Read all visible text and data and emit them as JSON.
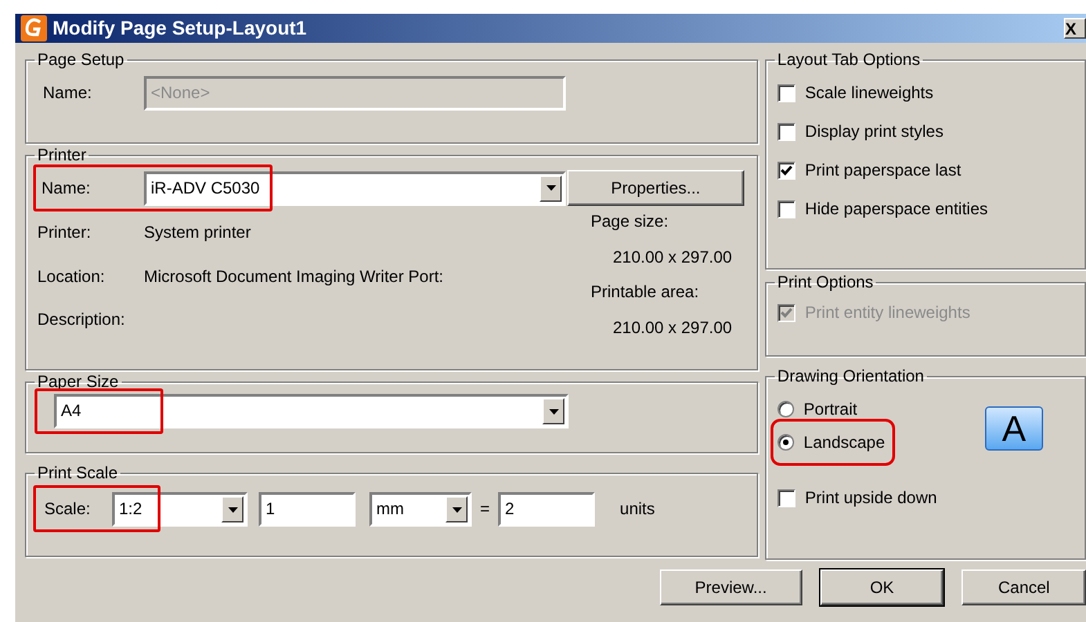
{
  "window": {
    "title": "Modify Page Setup-Layout1",
    "close": "X"
  },
  "page_setup": {
    "title": "Page Setup",
    "name_label": "Name:",
    "name_value": "<None>",
    "disabled": true
  },
  "printer": {
    "title": "Printer",
    "name_label": "Name:",
    "name_value": "iR-ADV C5030",
    "highlighted": true,
    "properties_button": "Properties...",
    "info": [
      {
        "label": "Printer:",
        "value": "System printer"
      },
      {
        "label": "Location:",
        "value": "Microsoft Document Imaging Writer Port:"
      },
      {
        "label": "Description:"
      }
    ],
    "page_size_label": "Page size:",
    "page_size": "210.00 x 297.00",
    "printable_area_label": "Printable area:",
    "printable_area": "210.00 x 297.00"
  },
  "paper_size": {
    "title": "Paper Size",
    "value": "A4",
    "highlighted": true
  },
  "print_scale": {
    "title": "Print Scale",
    "label": "Scale:",
    "scale": "1:2",
    "highlighted": true,
    "amount": "1",
    "unit": "mm",
    "equals": "=",
    "units_value": "2",
    "units_label": "units"
  },
  "layout_tab_options": {
    "title": "Layout Tab Options",
    "options": [
      {
        "label": "Scale lineweights",
        "checked": false,
        "disabled": false
      },
      {
        "label": "Display print styles",
        "checked": false,
        "disabled": false
      },
      {
        "label": "Print paperspace last",
        "checked": true,
        "disabled": false
      },
      {
        "label": "Hide paperspace entities",
        "checked": false,
        "disabled": false
      }
    ]
  },
  "print_options": {
    "title": "Print Options",
    "options": [
      {
        "label": "Print entity lineweights",
        "checked": true,
        "disabled": true
      }
    ]
  },
  "drawing_orientation": {
    "title": "Drawing Orientation",
    "choices": [
      {
        "label": "Portrait",
        "selected": false,
        "highlighted": false
      },
      {
        "label": "Landscape",
        "selected": true,
        "highlighted": true
      }
    ],
    "icon_letter": "A",
    "upside_down": {
      "label": "Print upside down",
      "checked": false
    }
  },
  "buttons": [
    {
      "label": "Preview...",
      "default": false
    },
    {
      "label": "OK",
      "default": true
    },
    {
      "label": "Cancel",
      "default": false
    }
  ]
}
